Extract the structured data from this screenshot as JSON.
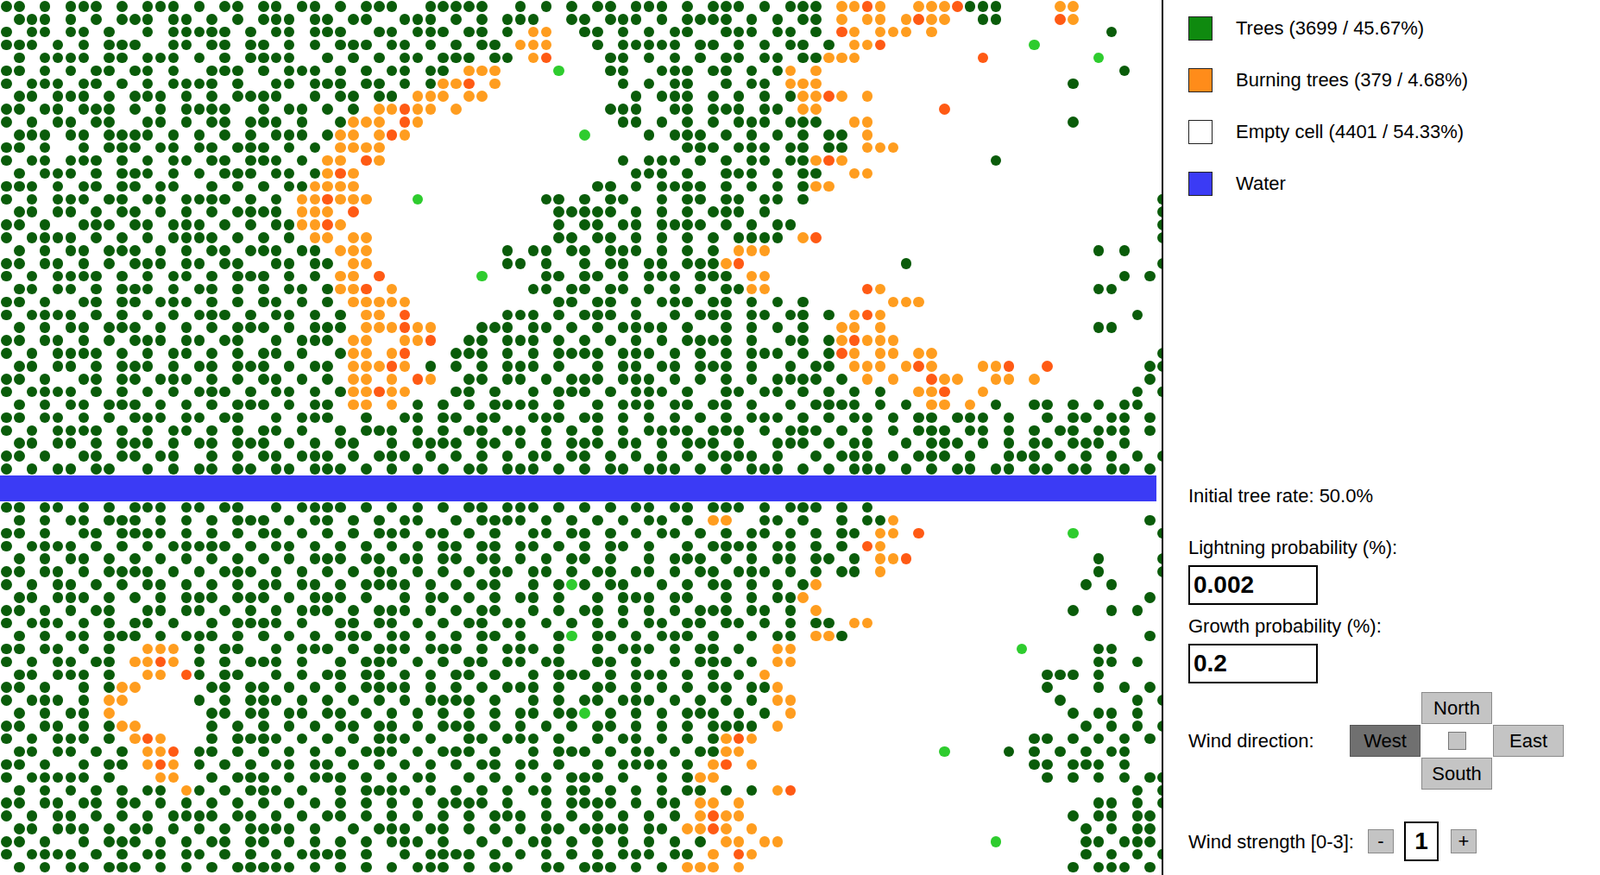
{
  "legend": [
    {
      "label": "Trees (3699 / 45.67%)",
      "color": "#0f8a0f"
    },
    {
      "label": "Burning trees (379 / 4.68%)",
      "color": "#ff8c1a"
    },
    {
      "label": "Empty cell (4401 / 54.33%)",
      "color": "#ffffff"
    },
    {
      "label": "Water",
      "color": "#3b3bf5"
    }
  ],
  "initial_tree_rate": "Initial tree rate: 50.0%",
  "fields": [
    {
      "label": "Lightning probability (%):",
      "value": "0.002"
    },
    {
      "label": "Growth probability (%):",
      "value": "0.2"
    }
  ],
  "wind": {
    "label": "Wind direction:",
    "directions": [
      {
        "label": "North",
        "selected": false
      },
      {
        "label": "West",
        "selected": true
      },
      {
        "label": "East",
        "selected": false
      },
      {
        "label": "South",
        "selected": false
      }
    ],
    "center_selected": false,
    "strength_label": "Wind strength [0-3]:",
    "decrease": "-",
    "strength": "1",
    "increase": "+"
  },
  "grid": {
    "cell_types": [
      {
        "symbol": "T",
        "name": "tree-cell",
        "kind": "dot",
        "color": "#0a5c0a"
      },
      {
        "symbol": "Y",
        "name": "young-tree-cell",
        "kind": "dot",
        "color": "#2ecc2e"
      },
      {
        "symbol": "B",
        "name": "burning-cell",
        "kind": "dot",
        "color": "#ff9d1f"
      },
      {
        "symbol": "R",
        "name": "burning-cell",
        "kind": "dot",
        "color": "#ff5a14"
      },
      {
        "symbol": "~",
        "name": "water-cell",
        "kind": "fill",
        "color": "#3b3bf5"
      },
      {
        "symbol": ".",
        "name": "empty-cell",
        "kind": "none",
        "color": "#ffffff"
      }
    ],
    "rows": [
      "TT.T.TTT.T.TTT.T.TT.TT.TT.T.TTT..TTTTT..T.T.T.TT.TTT.T.TTT.T.TTT.BBRB..BBBRTTT....BB......",
      ".TTT.T.T.TTT.TT.T.T.TTT.TT.TT..TTT.T.T.TTT..TT.TTT.T.TTTT.T.T.TT.B.BB.BRBB..TT....RB......",
      "T.TT.TT.T..T.TTTTT.T.TT.TTT..TT.TTT.TT.T.BB..TT.T.T.TT..TTT.TT.T.RB.BBB.B.............T.",
      "TTT.T.T.TTT..TT.TT.TT.T.T.TTT.TT.T.T.TT.BBB...T.TTTTT.TT.T.T.TT.T.BBR...........Y.......",
      ".T.TTTT.TT.TTT.T.T.TTTT..T.T.T.TT.TTT.TT.BR....TT.T.T.T.TT.TT.TTBBB.........R........Y...",
      "TT.T.T.TT.TT.T..TTT.T.TTT.T.T.TT.TT.BBB....Y...TT..TTT.TT.T.TB.B.......................T.",
      "T.TTT.TT.T.T.TTTT.T..TT.TTT.TT.T.TBBR.B.........T.T.TT..T.TT.BBB...................T......",
      ".TT.TTT.T.TTT.T.T.TTTT..T.TT.TT.BBB.BB...........T.TTT.T.T.T.TBBRB.B.......................YY.",
      "TT.TT.TTT.T.T.TTTT..T.TT.T.T.BBRBB.B...........TTT..TT.TTT.TT.BB.........R................",
      "T.T.TT.TT..TT.T.TT.TTT.T..TBBB.RB...............TT.T.T.T.TTT.TTT..BB...............T.........T",
      ".TTT.TT.TTTT.T.T.T.T.TTT.TBB.BRB.............Y....T.TTT.T.T.T.T.TT.B.........................",
      "TT.T..T.TTT.TT.TT.TTT.T.T.BBBB.......................TTT.TTT.TT.TT.BBB.......................T",
      "T.TT.TTT.T.T.TT.TT.TTT.T.BB.RB..................T.TTT.T.T.TT.TTBRB...........T..............T",
      ".T.TTT.T.TTT.T.T.TTT.TT.TBRB.....................TTT.T..TTT.T.TT..BB........................TT",
      "TTT.T.TT.TT.TT..T.T.T.TTBBBB..................TT.T.TTTT.T.T.T.TBB..........................T",
      "T.T.TTT.TT.TT.TTTT.T.T.BBRBBB...Y.........TT.T.TT..T.TT.TT.TT.T...........................TT.",
      ".TT.TT.T.TT.T.T.T.TTTT.BBB.R...............TTTTT.T.T.T.TTT.T..............................T.",
      "TT.T..TTT.TT.TTT.T.T.TTBBRB................T.TT.TT.TTTT.T.T.TT............................T",
      "T.TTTT.T.T.T.TTTT.T.T.T.BB.BB..............TT.TT.T.T.T.T.TTTT.BR..........................TT",
      ".T.T.TT.TTT.T.T.TT.TTT.TT.BBB..........T.TT.TT.TTT.T.T.T.BBB.........................T.T",
      "TT.TT.T.T.TTT.TT.TT..TT.TT.BB..........TT.T..T.TT.TT.TTTBR............T...................T",
      "T.T.TTTT.T.T.TT.T.TTT.T.T.BB.R.......Y....TT.TT.T.TTT.TTT.BB...........................T.T",
      ".TT.TT.T.TTT.T.TT.T.T.TT.TBBR.B..........TT.TT.TT.T.T.T.TTBB.......RB................TT",
      "TT.T..TT.TT.TTT.T.T.TT.T.T.BBBBB...........TT.TT.T.TTT.TT.T.T.T......BBB.....................T.T",
      "T.TTTT.T.T.T.T.TTT.T.TT.T.T.BB.R.......TTT.T.TTT.T..T.TTT.TT.TT.T.BRB...................T",
      ".T.T.TT.TTT.T.T.T.TTT.T.TTT.BBBRBB...TTT.TT.T.T.TTTT.T..T.T.T.T..BB.B................TT",
      "TT.TT.T.T.TTT.TT.TT..T.TTT.BB..BBR..TT.TTT.T.T.T.T.T.TTTT.T..TT.TBRBBB.....................T.T",
      "T.T.TTTT.T.T.TT.T.T.TT.T..TBB.BR...TTT.T.T.TTTT.TTT.T.T.T.TTT.T.TRB.BB.BB.................T",
      ".TT.TT.T.TTT.T.TT.TTT.T.TT.BBBRB.T.T.T.TTT.T..T.TT.TT.TTT.T..T.TT.BBB.BRB...BBR..R.......TT",
      "TT.T..TT.TT.TTT.T.T.TT.T.T.BB.B.RB..TT.TT.T.TTT.TTT.T.T.T.T.TTTT.T.B.B..RBB..BB.B........T.T",
      "T.TTTT.T.T.T.T.TTT.T.TT.T.TBBRBB...TT.T..T.TTT.T.TTT.T..TT.TT.T.T.T.T..BBR..B...........T.TT",
      ".T.T.TT.TTT.T.T.T.TTT.T.TT.BB.B.T.T.T.TTTT.T..T.TTT.TT.TT.T..T.TTTT.T.T.BB.B.T..TT.T.T.TT.",
      "TT.TT.T.T.TTT.TT.TT..T.TTT..T..TT.TT.TT..TTT.TT.T.T.T.T.T.TTT.T.T.TT.T.TT.TTT.T..T.TT.TT.T",
      "T.T.TTTT.T.T.TT.T.T.TT.T..T.TTT.T.T.TT.TT.T.T.T.T.TTTT.TTT.T.TTT.T.T.T.TTT.TT.T.T.TT.TTT.T.T",
      ".TT.TT.T.TTT.T.TT.TTT.T.T.TT..T.TTTT.TT.T.T.TTT.TT.T.TTT.T..TTT.T.TT..T.TTT.T.T.TT.TTT.T.",
      "TT.T..TT.TT.TT..T.T.TT.TTT.T.TTT.T.T.T.T.TT.TT.T.T.T.T.TTTT.T..T.TTT.T.TTT.T..TTT.T.T.T.T.TT",
      "T.T.TT.TT..T.T.TT.TT.TT.TTT.T.T.T.T.TT.TTT.T.T.TT.TTT.T.T.TTT.T.T.TTT.T.T.TT.TT.TT.TT.TT.T.T",
      "~~~~~~~~~~~~~~~~~~~~~~~~~~~~~~~~~~~~~~~~~~~~~~~~~~~~~~~~~~~~~~~~~~~~~~~~~~~~~~~~~~~~~~~~~~",
      "~~~~~~~~~~~~~~~~~~~~~~~~~~~~~~~~~~~~~~~~~~~~~~~~~~~~~~~~~~~~~~~~~~~~~~~~~~~~~~~~~~~~~~~~~~",
      "TT.TT.T.T.TTT.TT.TT..T.TTTT.T.T.T.T.TT.TTT.T.T.T.TT.TT.TTT.T.TTT.T.T...........................T.",
      ".T.T.TT.TTT.T.T.T.TTT.T.TT.T.T.TT..T.TTTT.T.T.T.T.TT.T.BB..TT.T..T.TTB...................T",
      "TT.T..TT.TTTT.T.T.T.TT.T.T.T.TTT.TT.T.T..TT.TT.T.T.TT.T.T.TT.T.T.TT.BB.R...........Y......T",
      "T.TTTT.T.T.T.TTTTT.T.TT.T.T.T.T.T.TT.TT.TT.T.T.TT.T..T.TTTT.TT.T.T.RB.........................",
      ".T.T.TT.T.T.T.T.T.T.T.T.TTT.TT.TT.TT.TT.T.T.TT.T..T.TTT.T.T.TT.TT.T.BBR..............T....T.",
      "TT.TT.T.TTTT.T.T.TTT.T.T.T.T.TT.T.T.T.TT.TT.T.TT.TT.T.TT.TTT.T.T.TT.B................T....TT",
      "T.T.TT.T.T.TT.T.T.T.TT.TT.T.TTTT.T.T.TT..T.TYT.TT..T.T.TT.T.T.TB....................T.T",
      ".TT.TTT.T.T.T.TTT.TTT.T.TTT.T..T.TT.T.T.TT.T..T.TTT.TT..T.T.TTB..........................T.",
      "TT.T.T.TT..TT.TT.T.T.T.TTT.T.TTT.T.T.TT..T.T.TT.T.T.T.TTT.TT.T.B...................T..T.T",
      "T.TTT.T.T.TT.T..T.TTTT.T..TT.TT.T.T.TT.TT.T.T.T.T.TT.TT.TT.T.T.TT.BB.......................TTT.",
      ".T.T.TT.TTT.T.TTT.T.T.T.T.TTT.TT.T.T.TT.T..TY.TT.T.TTT.T..T.TT.BBT.......................T.T.T",
      "TT.TT.T.T..BBB.T.TT..T.TTT.T.TTT.TTT.T.TTT.T..T.TTT.T.TT.T..BB.................Y.....TT.",
      "T.T.TT.TT.BBRB.T.T.TTT.T..T.TTT.T.T.TT.TT.TT..TT.T..T.TTT.T.BB.......................TT.T",
      ".TT.TTT.T..BB.RT.TT..T.T.TT.TT.T.T.TT.T..T.TTT.T.TTT.T.T.T.B.....................TTT.T.",
      "TT.T..T.TBB.....TT.TT.T.T.T.TTTT.T.T.T.TTT.T..TT.T.T.T.TT.TTB....................T...T.T.T",
      "T.TTT.T.BB.....T.T.TTT.T.T.T.T.T.TTTT.T..T.T.TT.TTT.T.T.T.T.BB....................T.....T.TT",
      ".T.T.TT.B.......TT.TT.TT.TT.T.T.T.T.T.T.TT.TTY.T.T.T.TTT.T.T.B.....................T.TT.T.",
      "TT.TT.T.TBB.....T.T.T.T.T.TT.TT.T.TTT.T.T.T.T.TT.T.T.T.TTTT.B.......................T.T.T.TT",
      "T.T.TTT.T.BRB...T.TTTT.T.T.T.TTT.T..TT.TTT.T..T.TT.T.T.TBRB.....................TT.T.T.T.T",
      ".TT.TT.T.T.BBR.TT.T.T.T.T.T.TTT.T.TTT.T..T.TTT.T.TT.T.TTBB...............Y....T.T.T.T.TT",
      "TT.T..T.TT.BRB.T.T.T.TT.TT.T.T.T.T.T.TT.TT.T..T.TTTT.T.BR.B.....................TT.TTT.T.",
      "T.TTTTT.T...BB..T.TTT.T.TTT.T.T.TT..T.T.T.T.TTT.T..T.TBB.........................T.T.T.T.TT",
      ".T.T.T.T.T.TT.BT.T.TTT.T..T.TTTT.T.T.T.T.TT.TT.T.T.T.TT.T.T.BR..........................T.TTTT.T.",
      "TT.TT.TT.TT.T.T.T.T.T.T.T.T.T.T.T.TTTT.T..T.TTTT.T.TT.BB.B...........................TT.T.T.T.T",
      "T.T.TT.T.T.T.TTTT.TT.T.T.TT.T.T.T.T.T.TTT.T.T.T.T.T.T.BRBB.........................T.TT.TT.T",
      ".TT.TTT.T.TT.T.T.T.TTTT.T..T.TTT.TT.T.T.T.TT.TTTT.TT.BBRB.B.........................T.T.TT.T.T",
      "TT.T..T.TTT.T.T.TT.TT.T.T.T.T.TTT.T..T.T.TT.T.T.T.T.T.T.BB.BB................Y......TT.TTT.T.",
      "T.TTTT.T.T.TT.TT.T.T.T.TTTT.T..T.TTTT.T.T.T.T.T.TTT.TT.B.RB.........................T.T.T.T.TT",
      ".T.T.TT.TTT.T.T.T.TTTTT.T.T.T.T.TTT.T.TT..TT.TTT.T.T.BBB.B.........................T.TTT.T.T"
    ]
  }
}
